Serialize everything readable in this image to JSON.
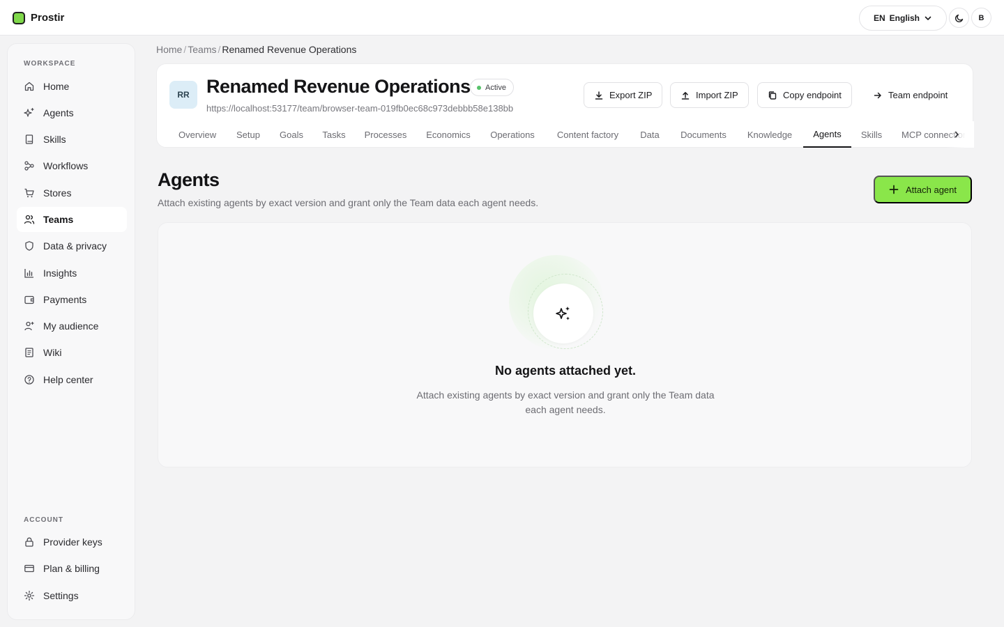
{
  "app": {
    "name": "Prostir",
    "language": {
      "code": "EN",
      "label": "English"
    },
    "user_initial": "B"
  },
  "sidebar": {
    "workspace_label": "WORKSPACE",
    "account_label": "ACCOUNT",
    "workspace_items": [
      {
        "label": "Home",
        "icon": "home-icon"
      },
      {
        "label": "Agents",
        "icon": "sparkles-icon"
      },
      {
        "label": "Skills",
        "icon": "book-icon"
      },
      {
        "label": "Workflows",
        "icon": "workflow-icon"
      },
      {
        "label": "Stores",
        "icon": "cart-icon"
      },
      {
        "label": "Teams",
        "icon": "users-icon",
        "active": true
      },
      {
        "label": "Data & privacy",
        "icon": "shield-icon"
      },
      {
        "label": "Insights",
        "icon": "bar-chart-icon"
      },
      {
        "label": "Payments",
        "icon": "wallet-icon"
      },
      {
        "label": "My audience",
        "icon": "audience-icon"
      },
      {
        "label": "Wiki",
        "icon": "document-icon"
      },
      {
        "label": "Help center",
        "icon": "help-icon"
      }
    ],
    "account_items": [
      {
        "label": "Provider keys",
        "icon": "lock-icon"
      },
      {
        "label": "Plan & billing",
        "icon": "credit-card-icon"
      },
      {
        "label": "Settings",
        "icon": "gear-icon"
      }
    ]
  },
  "breadcrumb": [
    "Home",
    "Teams",
    "Renamed Revenue Operations"
  ],
  "breadcrumb_separator": "/",
  "team": {
    "initials": "RR",
    "name": "Renamed Revenue Operations",
    "status": "Active",
    "url": "https://localhost:53177/team/browser-team-019fb0ec68c973debbb58e138bb",
    "actions": {
      "export": "Export ZIP",
      "import": "Import ZIP",
      "copy": "Copy endpoint",
      "endpoint": "Team endpoint"
    },
    "tabs": [
      "Overview",
      "Setup",
      "Goals",
      "Tasks",
      "Processes",
      "Economics",
      "Operations",
      "Content factory",
      "Data",
      "Documents",
      "Knowledge",
      "Agents",
      "Skills",
      "MCP connections"
    ],
    "active_tab": "Agents"
  },
  "page": {
    "title": "Agents",
    "subtitle": "Attach existing agents by exact version and grant only the Team data each agent needs.",
    "primary_action": "Attach agent"
  },
  "empty_state": {
    "icon": "sparkles-icon",
    "title": "No agents attached yet.",
    "description": "Attach existing agents by exact version and grant only the Team data each agent needs."
  },
  "colors": {
    "accent": "#8ae64a",
    "brand": "#7fd84a",
    "status_active": "#57c26a",
    "avatar_bg": "#dcedf7"
  }
}
